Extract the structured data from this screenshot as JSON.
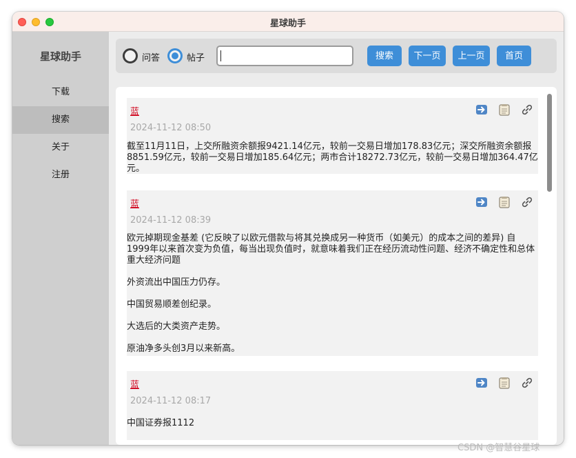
{
  "window": {
    "title": "星球助手"
  },
  "sidebar": {
    "app_name": "星球助手",
    "items": [
      {
        "label": "下载",
        "active": false
      },
      {
        "label": "搜索",
        "active": true
      },
      {
        "label": "关于",
        "active": false
      },
      {
        "label": "注册",
        "active": false
      }
    ]
  },
  "toolbar": {
    "radio_options": [
      {
        "label": "问答",
        "selected": false
      },
      {
        "label": "帖子",
        "selected": true
      }
    ],
    "search_value": "",
    "buttons": {
      "search": "搜索",
      "next": "下一页",
      "prev": "上一页",
      "home": "首页"
    }
  },
  "posts": [
    {
      "author": "蓝",
      "time": "2024-11-12 08:50",
      "paragraphs": [
        "截至11月11日，上交所融资余额报9421.14亿元，较前一交易日增加178.83亿元；深交所融资余额报8851.59亿元，较前一交易日增加185.64亿元；两市合计18272.73亿元，较前一交易日增加364.47亿元。"
      ]
    },
    {
      "author": "蓝",
      "time": "2024-11-12 08:39",
      "paragraphs": [
        "欧元掉期现金基差 (它反映了以欧元借款与将其兑换成另一种货币（如美元）的成本之间的差异) 自1999年以来首次变为负值，每当出现负值时，就意味着我们正在经历流动性问题、经济不确定性和总体重大经济问题",
        "外资流出中国压力仍存。",
        "中国贸易顺差创纪录。",
        "大选后的大类资产走势。",
        "原油净多头创3月以来新高。"
      ]
    },
    {
      "author": "蓝",
      "time": "2024-11-12 08:17",
      "paragraphs": [
        "中国证券报1112"
      ]
    }
  ],
  "icons": {
    "open": "arrow-right-icon",
    "copy": "clipboard-icon",
    "link": "link-icon"
  },
  "colors": {
    "accent": "#3e8ed8",
    "author": "#d0021b",
    "time": "#a8a8a8"
  },
  "watermark": "CSDN @智慧谷星球"
}
